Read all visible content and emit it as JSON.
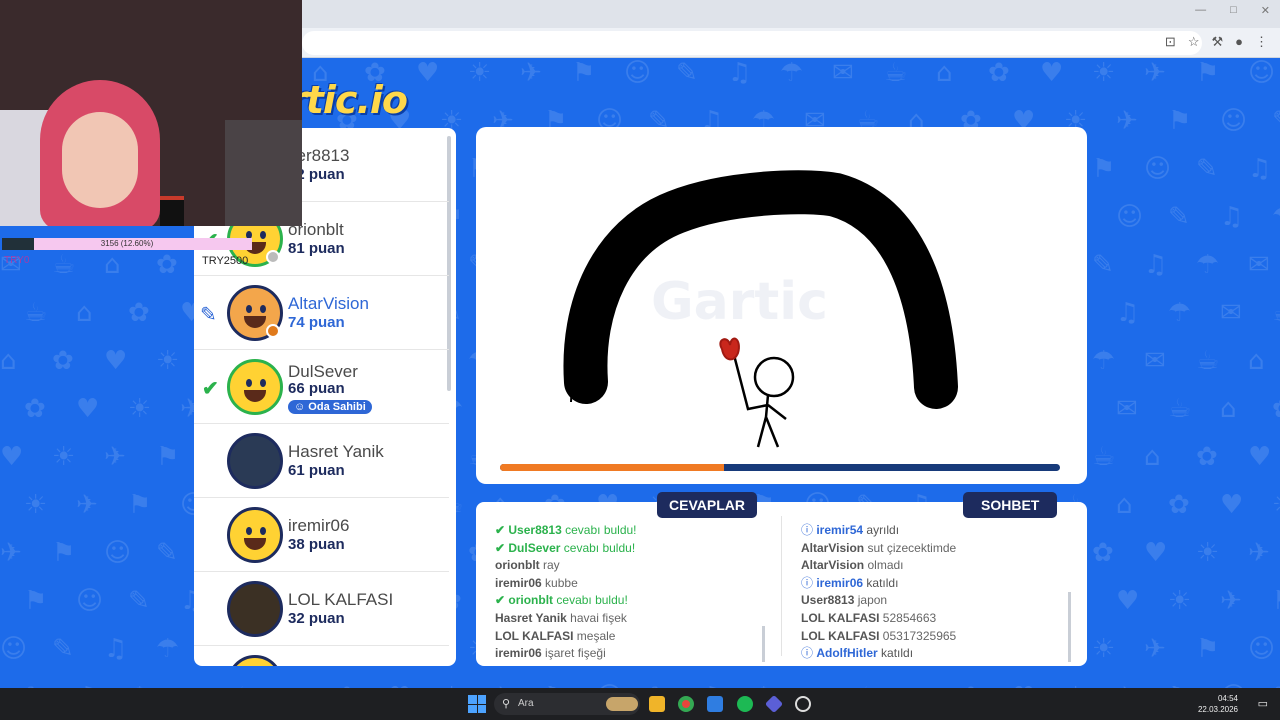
{
  "taskbar": {
    "search_placeholder": "Ara",
    "time": "04:54",
    "date": "22.03.2026"
  },
  "stream_overlay": {
    "sub_goal_text": "3156 (12.60%)",
    "left_label": "TRY0",
    "right_label": "TRY2500",
    "progress": 0.126
  },
  "players": [
    {
      "name": "ser8813",
      "points": "02 puan",
      "status": "none"
    },
    {
      "name": "orionblt",
      "points": "81 puan",
      "status": "guessed"
    },
    {
      "name": "AltarVision",
      "points": "74 puan",
      "status": "drawing"
    },
    {
      "name": "DulSever",
      "points": "66 puan",
      "status": "guessed",
      "badge": "Oda Sahibi"
    },
    {
      "name": "Hasret Yanik",
      "points": "61 puan",
      "status": "none"
    },
    {
      "name": "iremir06",
      "points": "38 puan",
      "status": "none"
    },
    {
      "name": "LOL KALFASI",
      "points": "32 puan",
      "status": "none"
    }
  ],
  "canvas": {
    "watermark": "Gartic",
    "time_left": 0.4
  },
  "answers": {
    "tab_label": "CEVAPLAR",
    "messages": [
      {
        "user": "User8813",
        "text": "cevabı buldu!",
        "kind": "correct"
      },
      {
        "user": "DulSever",
        "text": "cevabı buldu!",
        "kind": "correct"
      },
      {
        "user": "orionblt",
        "text": "ray",
        "kind": "guess"
      },
      {
        "user": "iremir06",
        "text": "kubbe",
        "kind": "guess"
      },
      {
        "user": "orionblt",
        "text": "cevabı buldu!",
        "kind": "correct"
      },
      {
        "user": "Hasret Yanik",
        "text": "havai fişek",
        "kind": "guess"
      },
      {
        "user": "LOL KALFASI",
        "text": "meşale",
        "kind": "guess"
      },
      {
        "user": "iremir06",
        "text": "işaret fişeği",
        "kind": "guess"
      }
    ]
  },
  "chat": {
    "tab_label": "SOHBET",
    "messages": [
      {
        "user": "iremir54",
        "text": "ayrıldı",
        "kind": "info"
      },
      {
        "user": "AltarVision",
        "text": "sut çizecektimde",
        "kind": "msg"
      },
      {
        "user": "AltarVision",
        "text": "olmadı",
        "kind": "msg"
      },
      {
        "user": "iremir06",
        "text": "katıldı",
        "kind": "info"
      },
      {
        "user": "User8813",
        "text": "japon",
        "kind": "msg"
      },
      {
        "user": "LOL KALFASI",
        "text": "52854663",
        "kind": "msg"
      },
      {
        "user": "LOL KALFASI",
        "text": "05317325965",
        "kind": "msg"
      },
      {
        "user": "AdolfHitler",
        "text": "katıldı",
        "kind": "info"
      }
    ]
  },
  "colors": {
    "accent": "#2e67d6",
    "navy": "#1d2b5e",
    "correct": "#2bb24c",
    "timer": "#f07a23"
  }
}
